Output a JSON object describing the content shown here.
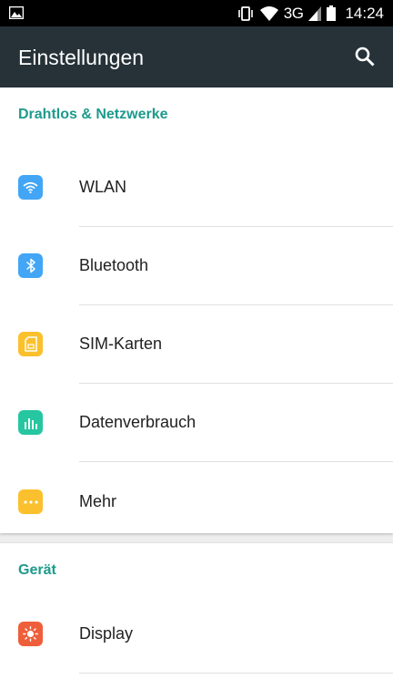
{
  "status_bar": {
    "network": "3G",
    "time": "14:24",
    "icons": [
      "image-notification-icon",
      "vibrate-icon",
      "wifi-icon",
      "signal-icon",
      "battery-icon"
    ]
  },
  "app_bar": {
    "title": "Einstellungen",
    "search_icon": "search-icon",
    "background": "#263238"
  },
  "accent_color": "#1e9a8c",
  "sections": [
    {
      "title": "Drahtlos & Netzwerke",
      "items": [
        {
          "label": "WLAN",
          "icon": "wifi-icon",
          "color": "#42a5f5"
        },
        {
          "label": "Bluetooth",
          "icon": "bluetooth-icon",
          "color": "#42a5f5"
        },
        {
          "label": "SIM-Karten",
          "icon": "sim-card-icon",
          "color": "#fbc02d"
        },
        {
          "label": "Datenverbrauch",
          "icon": "data-usage-icon",
          "color": "#26c6a0"
        },
        {
          "label": "Mehr",
          "icon": "more-icon",
          "color": "#fbc02d"
        }
      ]
    },
    {
      "title": "Gerät",
      "items": [
        {
          "label": "Display",
          "icon": "display-icon",
          "color": "#ef5e3a"
        }
      ]
    }
  ]
}
